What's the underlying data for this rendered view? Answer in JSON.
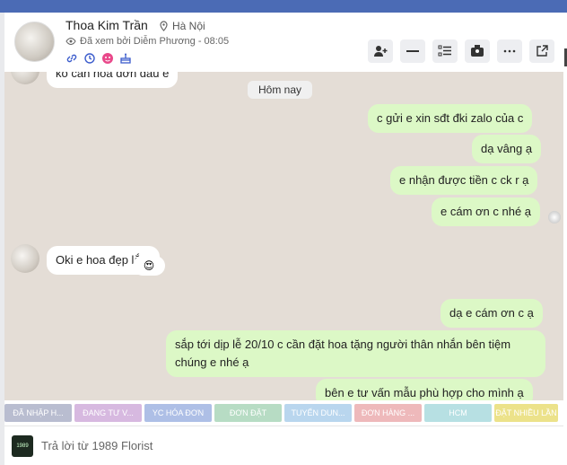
{
  "contact": {
    "name": "Thoa Kim Trần",
    "location": "Hà Nội",
    "seen_by": "Đã xem bởi Diễm Phương - 08:05"
  },
  "header_icons": [
    "link-icon",
    "history-icon",
    "face-icon",
    "cake-icon"
  ],
  "header_buttons": [
    "add-person-icon",
    "minus-icon",
    "list-icon",
    "inbox-icon",
    "more-icon",
    "open-external-icon"
  ],
  "date_separator": "Hôm nay",
  "messages": {
    "partial_top": "ko cần hoá đơn đâu e",
    "m1": "c gửi e xin sđt đki zalo của c",
    "m2": "dạ vâng ạ",
    "m3": "e nhận được tiền c ck r ạ",
    "m4": "e cám ơn c nhé ạ",
    "m5": "Oki e hoa đẹp lắm",
    "reaction": "😍",
    "m6": "dạ e cám ơn c ạ",
    "m7": "sắp tới dịp lễ 20/10 c cần đặt hoa tặng người thân nhắn bên tiệm chúng e nhé ạ",
    "m8": "bên e tư vấn mẫu phù hợp cho mình ạ"
  },
  "labels": [
    {
      "text": "ĐÃ NHẬP H...",
      "color": "#b9bdd0"
    },
    {
      "text": "ĐANG TƯ V...",
      "color": "#d7b9e0"
    },
    {
      "text": "YC HÓA ĐƠN",
      "color": "#aebfe6"
    },
    {
      "text": "ĐƠN ĐẶT",
      "color": "#b7dcc4"
    },
    {
      "text": "TUYỂN DUN...",
      "color": "#b9d6ee"
    },
    {
      "text": "ĐƠN HÀNG ...",
      "color": "#eeb9bb"
    },
    {
      "text": "HCM",
      "color": "#b7e0e3"
    },
    {
      "text": "Đặt nhiều lần",
      "color": "#ece28a"
    }
  ],
  "reply": {
    "text": "Trả lời từ 1989 Florist",
    "logo_text": "1989"
  }
}
